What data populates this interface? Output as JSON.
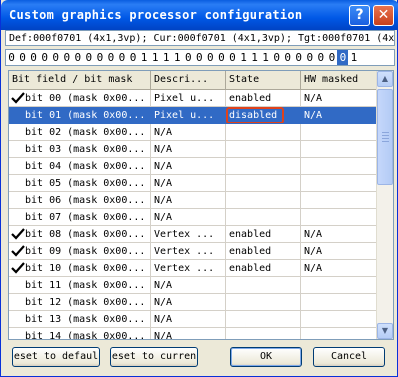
{
  "window": {
    "title": "Custom graphics processor configuration",
    "help_label": "?",
    "close_label": "✕"
  },
  "infobar": "Def:000f0701 (4x1,3vp); Cur:000f0701 (4x1,3vp); Tgt:000f0701 (4x",
  "bits": [
    "0",
    "0",
    "0",
    "0",
    "0",
    "0",
    "0",
    "0",
    "0",
    "0",
    "0",
    "0",
    "1",
    "1",
    "1",
    "1",
    "0",
    "0",
    "0",
    "0",
    "0",
    "1",
    "1",
    "1",
    "0",
    "0",
    "0",
    "0",
    "0",
    "0",
    "0",
    "1"
  ],
  "selected_bit_index": 30,
  "table": {
    "columns": [
      "Bit field / bit mask",
      "Descri...",
      "State",
      "HW masked"
    ],
    "rows": [
      {
        "checked": true,
        "bit": "bit 00 (mask 0x00...",
        "desc": "Pixel u...",
        "state": "enabled",
        "hw": "N/A"
      },
      {
        "checked": false,
        "bit": "bit 01 (mask 0x00...",
        "desc": "Pixel u...",
        "state": "disabled",
        "hw": "N/A",
        "selected": true,
        "highlight": true
      },
      {
        "checked": false,
        "bit": "bit 02 (mask 0x00...",
        "desc": "N/A",
        "state": "",
        "hw": ""
      },
      {
        "checked": false,
        "bit": "bit 03 (mask 0x00...",
        "desc": "N/A",
        "state": "",
        "hw": ""
      },
      {
        "checked": false,
        "bit": "bit 04 (mask 0x00...",
        "desc": "N/A",
        "state": "",
        "hw": ""
      },
      {
        "checked": false,
        "bit": "bit 05 (mask 0x00...",
        "desc": "N/A",
        "state": "",
        "hw": ""
      },
      {
        "checked": false,
        "bit": "bit 06 (mask 0x00...",
        "desc": "N/A",
        "state": "",
        "hw": ""
      },
      {
        "checked": false,
        "bit": "bit 07 (mask 0x00...",
        "desc": "N/A",
        "state": "",
        "hw": ""
      },
      {
        "checked": true,
        "bit": "bit 08 (mask 0x00...",
        "desc": "Vertex ...",
        "state": "enabled",
        "hw": "N/A"
      },
      {
        "checked": true,
        "bit": "bit 09 (mask 0x00...",
        "desc": "Vertex ...",
        "state": "enabled",
        "hw": "N/A"
      },
      {
        "checked": true,
        "bit": "bit 10 (mask 0x00...",
        "desc": "Vertex ...",
        "state": "enabled",
        "hw": "N/A"
      },
      {
        "checked": false,
        "bit": "bit 11 (mask 0x00...",
        "desc": "N/A",
        "state": "",
        "hw": ""
      },
      {
        "checked": false,
        "bit": "bit 12 (mask 0x00...",
        "desc": "N/A",
        "state": "",
        "hw": ""
      },
      {
        "checked": false,
        "bit": "bit 13 (mask 0x00...",
        "desc": "N/A",
        "state": "",
        "hw": ""
      },
      {
        "checked": false,
        "bit": "bit 14 (mask 0x00...",
        "desc": "N/A",
        "state": "",
        "hw": ""
      }
    ]
  },
  "scrollbar": {
    "up_label": "▲",
    "down_label": "▼"
  },
  "buttons": {
    "reset_default": "eset to defaul",
    "reset_current": "eset to curren",
    "ok": "OK",
    "cancel": "Cancel"
  },
  "colors": {
    "selection": "#316ac5",
    "highlight_outline": "#e0421b",
    "title_bar": "#0058e6"
  }
}
